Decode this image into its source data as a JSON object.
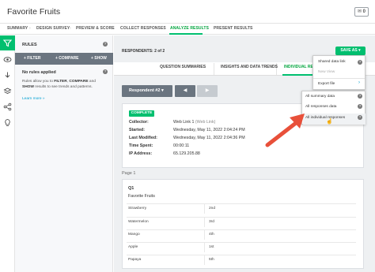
{
  "app": {
    "title": "Favorite Fruits",
    "badge_count": "0"
  },
  "nav": {
    "items": [
      "SUMMARY",
      "DESIGN SURVEY",
      "PREVIEW & SCORE",
      "COLLECT RESPONSES",
      "ANALYZE RESULTS",
      "PRESENT RESULTS"
    ],
    "active": "ANALYZE RESULTS"
  },
  "sidebar": {
    "title": "RULES",
    "filters": [
      "+ FILTER",
      "+ COMPARE",
      "+ SHOW"
    ],
    "no_rules": "No rules applied",
    "desc_prefix": "Rules allow you to",
    "desc_filter": "FILTER",
    "desc_compare": "COMPARE",
    "desc_and": "and",
    "desc_show": "SHOW",
    "desc_suffix": "results to see trends and patterns.",
    "learn_more": "Learn more »"
  },
  "main": {
    "respondents": "RESPONDENTS: 2 of 2",
    "save_as": "SAVE AS"
  },
  "tabs": [
    "QUESTION SUMMARIES",
    "INSIGHTS AND DATA TRENDS",
    "INDIVIDUAL RESPONSES"
  ],
  "response_nav": {
    "selected": "Respondent #2"
  },
  "response": {
    "status": "COMPLETE",
    "fields": [
      {
        "label": "Collector:",
        "value": "Web Link 1",
        "muted": " (Web Link)"
      },
      {
        "label": "Started:",
        "value": "Wednesday, May 11, 2022 2:04:24 PM",
        "muted": ""
      },
      {
        "label": "Last Modified:",
        "value": "Wednesday, May 11, 2022 2:04:36 PM",
        "muted": ""
      },
      {
        "label": "Time Spent:",
        "value": "00:00:11",
        "muted": ""
      },
      {
        "label": "IP Address:",
        "value": "65.129.205.88",
        "muted": ""
      }
    ]
  },
  "page": {
    "label": "Page 1"
  },
  "question": {
    "id": "Q1",
    "title": "Favorite Fruits",
    "rows": [
      {
        "name": "Strawberry",
        "rank": "2nd"
      },
      {
        "name": "Watermelon",
        "rank": "3rd"
      },
      {
        "name": "Mango",
        "rank": "4th"
      },
      {
        "name": "Apple",
        "rank": "1st"
      },
      {
        "name": "Papaya",
        "rank": "5th"
      }
    ]
  },
  "save_menu": {
    "items": [
      {
        "label": "Shared data link",
        "disabled": false
      },
      {
        "label": "New View",
        "disabled": true
      },
      {
        "label": "Export file",
        "disabled": false
      }
    ]
  },
  "export_menu": {
    "items": [
      "All summary data",
      "All responses data",
      "All individual responses"
    ]
  }
}
